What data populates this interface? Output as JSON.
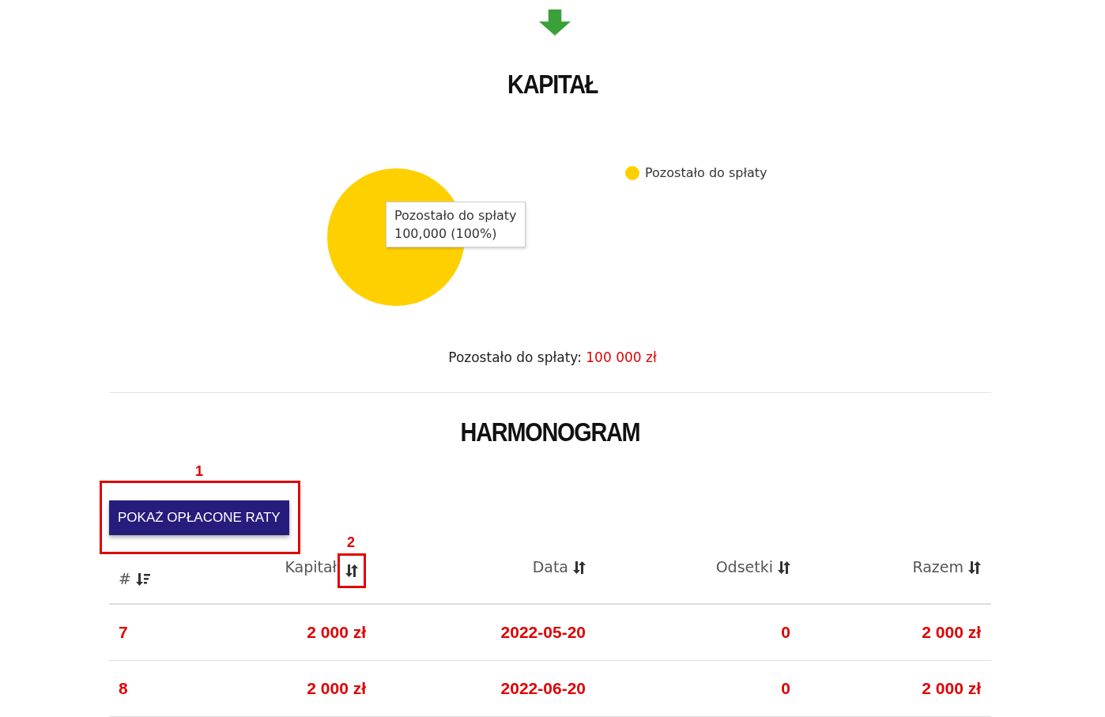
{
  "capital": {
    "title": "KAPITAŁ",
    "chart_data": {
      "type": "pie",
      "categories": [
        "Pozostało do spłaty"
      ],
      "series": [
        {
          "color": "#ffd000",
          "values": [
            100
          ]
        }
      ]
    },
    "tooltip": {
      "title": "Pozostało do spłaty",
      "value": "100,000 (100%)"
    },
    "summary": {
      "label": "Pozostało do spłaty:",
      "amount": "100 000 zł"
    }
  },
  "schedule": {
    "title": "HARMONOGRAM",
    "button": "POKAŻ OPŁACONE RATY",
    "columns": [
      {
        "label": "#",
        "sorted": true
      },
      {
        "label": "Kapitał",
        "sorted": false
      },
      {
        "label": "Data",
        "sorted": false
      },
      {
        "label": "Odsetki",
        "sorted": false
      },
      {
        "label": "Razem",
        "sorted": false
      }
    ],
    "rows": [
      [
        "7",
        "2 000 zł",
        "2022-05-20",
        "0",
        "2 000 zł"
      ],
      [
        "8",
        "2 000 zł",
        "2022-06-20",
        "0",
        "2 000 zł"
      ]
    ]
  },
  "annotations": [
    {
      "label": "1"
    },
    {
      "label": "2"
    }
  ]
}
